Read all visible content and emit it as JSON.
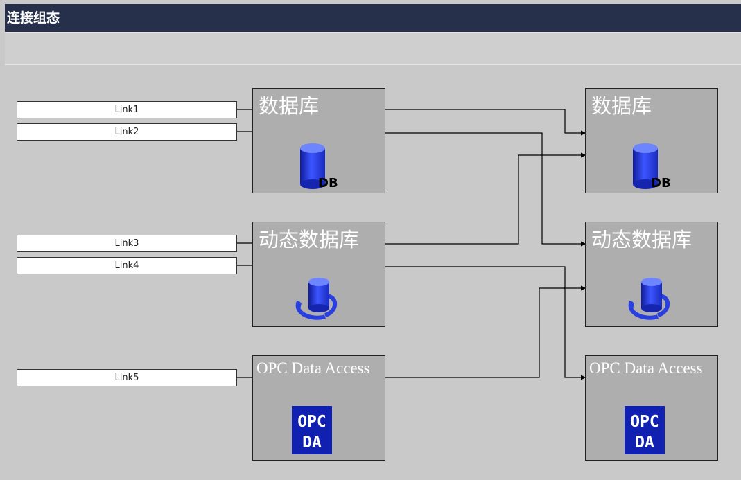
{
  "title": "连接组态",
  "links": [
    {
      "label": "Link1"
    },
    {
      "label": "Link2"
    },
    {
      "label": "Link3"
    },
    {
      "label": "Link4"
    },
    {
      "label": "Link5"
    }
  ],
  "left_blocks": [
    {
      "label": "数据库",
      "icon": "db-icon",
      "icon_text": "DB"
    },
    {
      "label": "动态数据库",
      "icon": "dynamic-db-icon"
    },
    {
      "label": "OPC Data Access",
      "icon": "opc-da-icon",
      "icon_text_top": "OPC",
      "icon_text_bottom": "DA"
    }
  ],
  "right_blocks": [
    {
      "label": "数据库",
      "icon": "db-icon",
      "icon_text": "DB"
    },
    {
      "label": "动态数据库",
      "icon": "dynamic-db-icon"
    },
    {
      "label": "OPC Data Access",
      "icon": "opc-da-icon",
      "icon_text_top": "OPC",
      "icon_text_bottom": "DA"
    }
  ],
  "colors": {
    "titlebar": "#27304a",
    "block": "#aeaeae",
    "db_blue": "#2b3de0",
    "opc_blue": "#1020b0"
  }
}
